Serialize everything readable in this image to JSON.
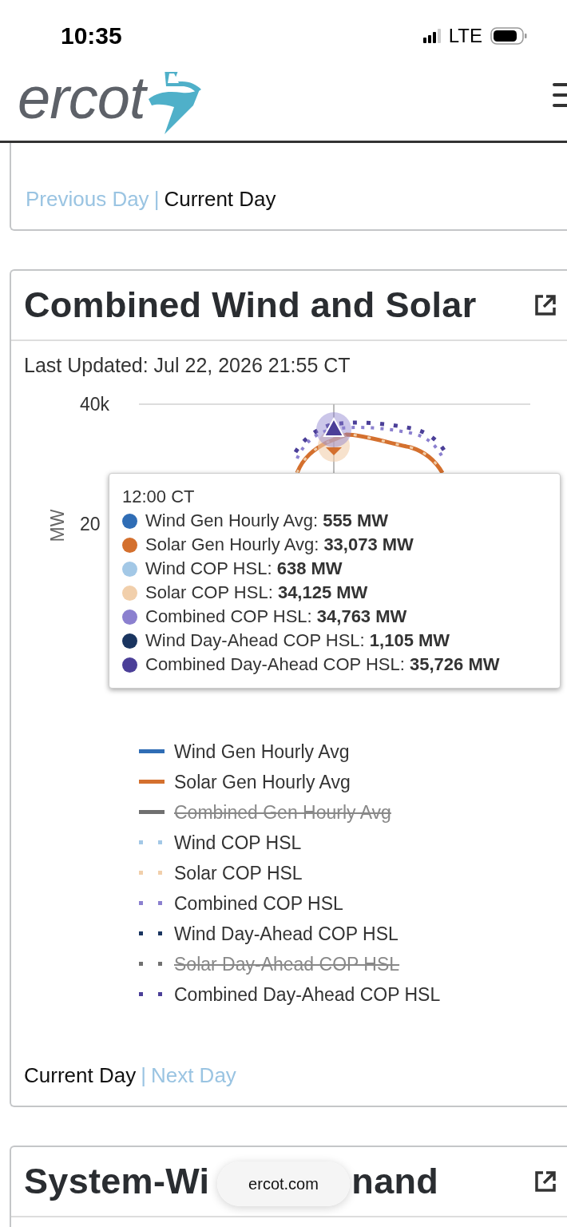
{
  "status_bar": {
    "time": "10:35",
    "network": "LTE"
  },
  "header": {
    "logo_text": "ercot"
  },
  "top_card": {
    "separator": "|",
    "links": [
      {
        "label": "Previous Day",
        "selected": false
      },
      {
        "label": "Current Day",
        "selected": true
      }
    ]
  },
  "wind_solar_card": {
    "title": "Combined Wind and Solar",
    "last_updated": "Last Updated: Jul 22, 2026 21:55 CT",
    "chart": {
      "y_axis_label": "MW",
      "y_ticks": [
        "40k",
        "20"
      ],
      "tooltip": {
        "title": "12:00 CT",
        "rows": [
          {
            "label": "Wind Gen Hourly Avg:",
            "value": "555 MW",
            "color": "#2f6db5"
          },
          {
            "label": "Solar Gen Hourly Avg:",
            "value": "33,073 MW",
            "color": "#d4702e"
          },
          {
            "label": "Wind COP HSL:",
            "value": "638 MW",
            "color": "#a3c8e6"
          },
          {
            "label": "Solar COP HSL:",
            "value": "34,125 MW",
            "color": "#f1cfab"
          },
          {
            "label": "Combined COP HSL:",
            "value": "34,763 MW",
            "color": "#8b80cf"
          },
          {
            "label": "Wind Day-Ahead COP HSL:",
            "value": "1,105 MW",
            "color": "#1a3560"
          },
          {
            "label": "Combined Day-Ahead COP HSL:",
            "value": "35,726 MW",
            "color": "#4b3f98"
          }
        ]
      }
    },
    "legend": [
      {
        "label": "Wind Gen Hourly Avg",
        "kind": "solid",
        "color": "#2f6db5",
        "hidden": false
      },
      {
        "label": "Solar Gen Hourly Avg",
        "kind": "solid",
        "color": "#d4702e",
        "hidden": false
      },
      {
        "label": "Combined Gen Hourly Avg",
        "kind": "solid",
        "color": "#707070",
        "hidden": true
      },
      {
        "label": "Wind COP HSL",
        "kind": "dotted",
        "color": "#a3c8e6",
        "hidden": false
      },
      {
        "label": "Solar COP HSL",
        "kind": "dotted",
        "color": "#f1cfab",
        "hidden": false
      },
      {
        "label": "Combined COP HSL",
        "kind": "dotted",
        "color": "#8b80cf",
        "hidden": false
      },
      {
        "label": "Wind Day-Ahead COP HSL",
        "kind": "dotted",
        "color": "#1a3560",
        "hidden": false
      },
      {
        "label": "Solar Day-Ahead COP HSL",
        "kind": "dotted",
        "color": "#707070",
        "hidden": true
      },
      {
        "label": "Combined Day-Ahead COP HSL",
        "kind": "dotted",
        "color": "#4b3f98",
        "hidden": false
      }
    ],
    "separator": "|",
    "links": [
      {
        "label": "Current Day",
        "selected": true
      },
      {
        "label": "Next Day",
        "selected": false
      }
    ]
  },
  "demand_card": {
    "title_left": "System-Wi",
    "title_right": "nand"
  },
  "browser_address": "ercot.com"
}
